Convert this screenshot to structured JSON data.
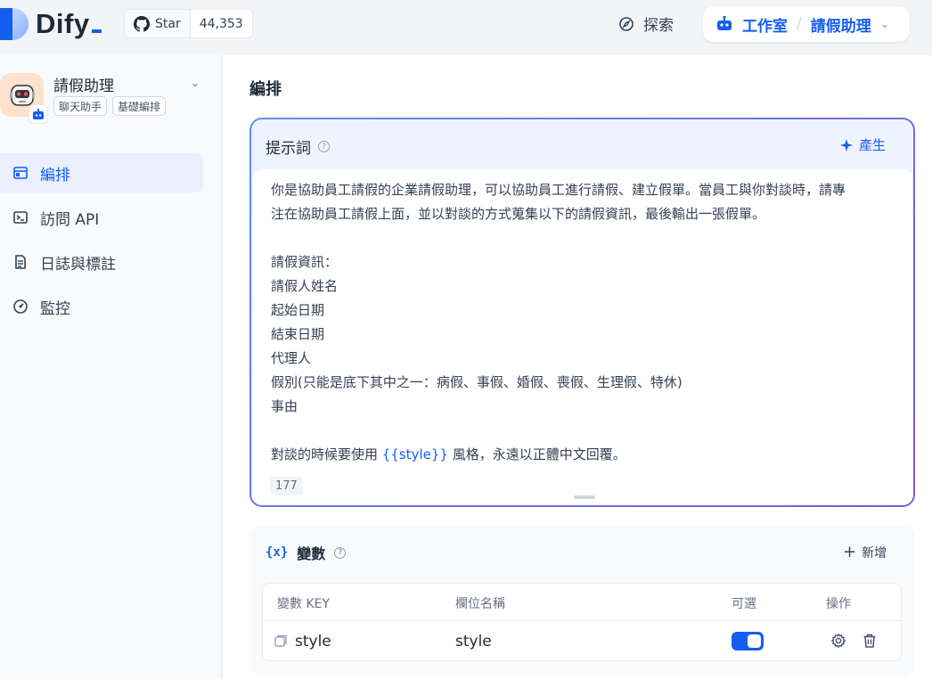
{
  "header": {
    "logo_text": "Dify",
    "github": {
      "star_label": "Star",
      "star_count": "44,353"
    },
    "explore_label": "探索",
    "studio_label": "工作室",
    "breadcrumb_sep": "/",
    "current_app": "請假助理"
  },
  "sidebar": {
    "app_name": "請假助理",
    "tags": [
      "聊天助手",
      "基礎編排"
    ],
    "items": [
      {
        "label": "編排",
        "icon": "layout-icon",
        "active": true
      },
      {
        "label": "訪問 API",
        "icon": "terminal-icon",
        "active": false
      },
      {
        "label": "日誌與標註",
        "icon": "document-icon",
        "active": false
      },
      {
        "label": "監控",
        "icon": "gauge-icon",
        "active": false
      }
    ]
  },
  "main": {
    "title": "編排",
    "prompt": {
      "heading": "提示詞",
      "generate_label": "產生",
      "text_before": "你是協助員工請假的企業請假助理，可以協助員工進行請假、建立假單。當員工與你對談時，請專\n注在協助員工請假上面，並以對談的方式蒐集以下的請假資訊，最後輸出一張假單。\n\n請假資訊：\n請假人姓名\n起始日期\n結束日期\n代理人\n假別(只能是底下其中之一：病假、事假、婚假、喪假、生理假、特休)\n事由\n\n對談的時候要使用 ",
      "variable_token": "{{style}}",
      "text_after": " 風格，永遠以正體中文回覆。",
      "char_count": "177"
    },
    "variables": {
      "icon_text": "{x}",
      "heading": "變數",
      "add_label": "新增",
      "columns": [
        "變數 KEY",
        "欄位名稱",
        "可選",
        "操作"
      ],
      "rows": [
        {
          "key": "style",
          "name": "style",
          "optional": true
        }
      ]
    }
  },
  "colors": {
    "accent": "#155eef",
    "active_bg": "#eaf0fe",
    "prompt_border_start": "#5d8ef6",
    "prompt_border_end": "#7f56d9"
  }
}
